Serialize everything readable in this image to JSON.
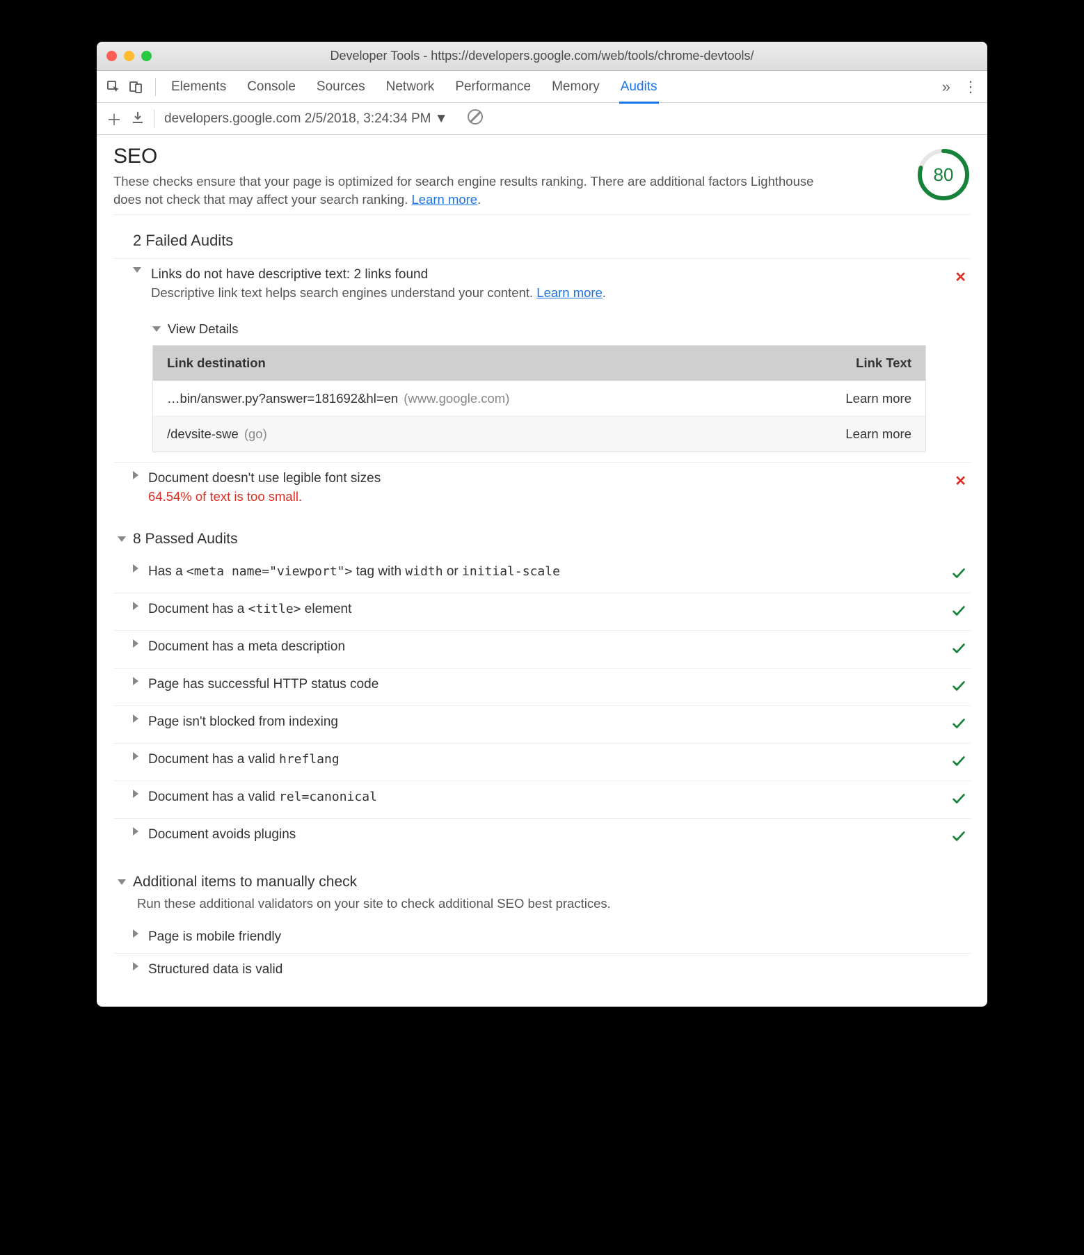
{
  "window": {
    "title": "Developer Tools - https://developers.google.com/web/tools/chrome-devtools/"
  },
  "tabs": [
    "Elements",
    "Console",
    "Sources",
    "Network",
    "Performance",
    "Memory",
    "Audits"
  ],
  "activeTab": "Audits",
  "subbar": {
    "runLabel": "developers.google.com 2/5/2018, 3:24:34 PM"
  },
  "seo": {
    "title": "SEO",
    "desc": "These checks ensure that your page is optimized for search engine results ranking. There are additional factors Lighthouse does not check that may affect your search ranking. ",
    "learnMore": "Learn more",
    "score": 80
  },
  "failed": {
    "heading": "2 Failed Audits",
    "items": [
      {
        "title": "Links do not have descriptive text: 2 links found",
        "sub": "Descriptive link text helps search engines understand your content. ",
        "learnMore": "Learn more",
        "expanded": true,
        "viewDetails": "View Details",
        "tableHead": {
          "dest": "Link destination",
          "text": "Link Text"
        },
        "rows": [
          {
            "dest": "…bin/answer.py?answer=181692&hl=en",
            "host": "(www.google.com)",
            "text": "Learn more"
          },
          {
            "dest": "/devsite-swe",
            "host": "(go)",
            "text": "Learn more"
          }
        ]
      },
      {
        "title": "Document doesn't use legible font sizes",
        "warn": "64.54% of text is too small.",
        "expanded": false
      }
    ]
  },
  "passed": {
    "heading": "8 Passed Audits",
    "items": [
      {
        "pre": "Has a ",
        "code": "<meta name=\"viewport\">",
        "mid": " tag with ",
        "code2": "width",
        "mid2": " or ",
        "code3": "initial-scale"
      },
      {
        "pre": "Document has a ",
        "code": "<title>",
        "mid": " element"
      },
      {
        "pre": "Document has a meta description"
      },
      {
        "pre": "Page has successful HTTP status code"
      },
      {
        "pre": "Page isn't blocked from indexing"
      },
      {
        "pre": "Document has a valid ",
        "code": "hreflang"
      },
      {
        "pre": "Document has a valid ",
        "code": "rel=canonical"
      },
      {
        "pre": "Document avoids plugins"
      }
    ]
  },
  "manual": {
    "heading": "Additional items to manually check",
    "desc": "Run these additional validators on your site to check additional SEO best practices.",
    "items": [
      {
        "title": "Page is mobile friendly"
      },
      {
        "title": "Structured data is valid"
      }
    ]
  }
}
